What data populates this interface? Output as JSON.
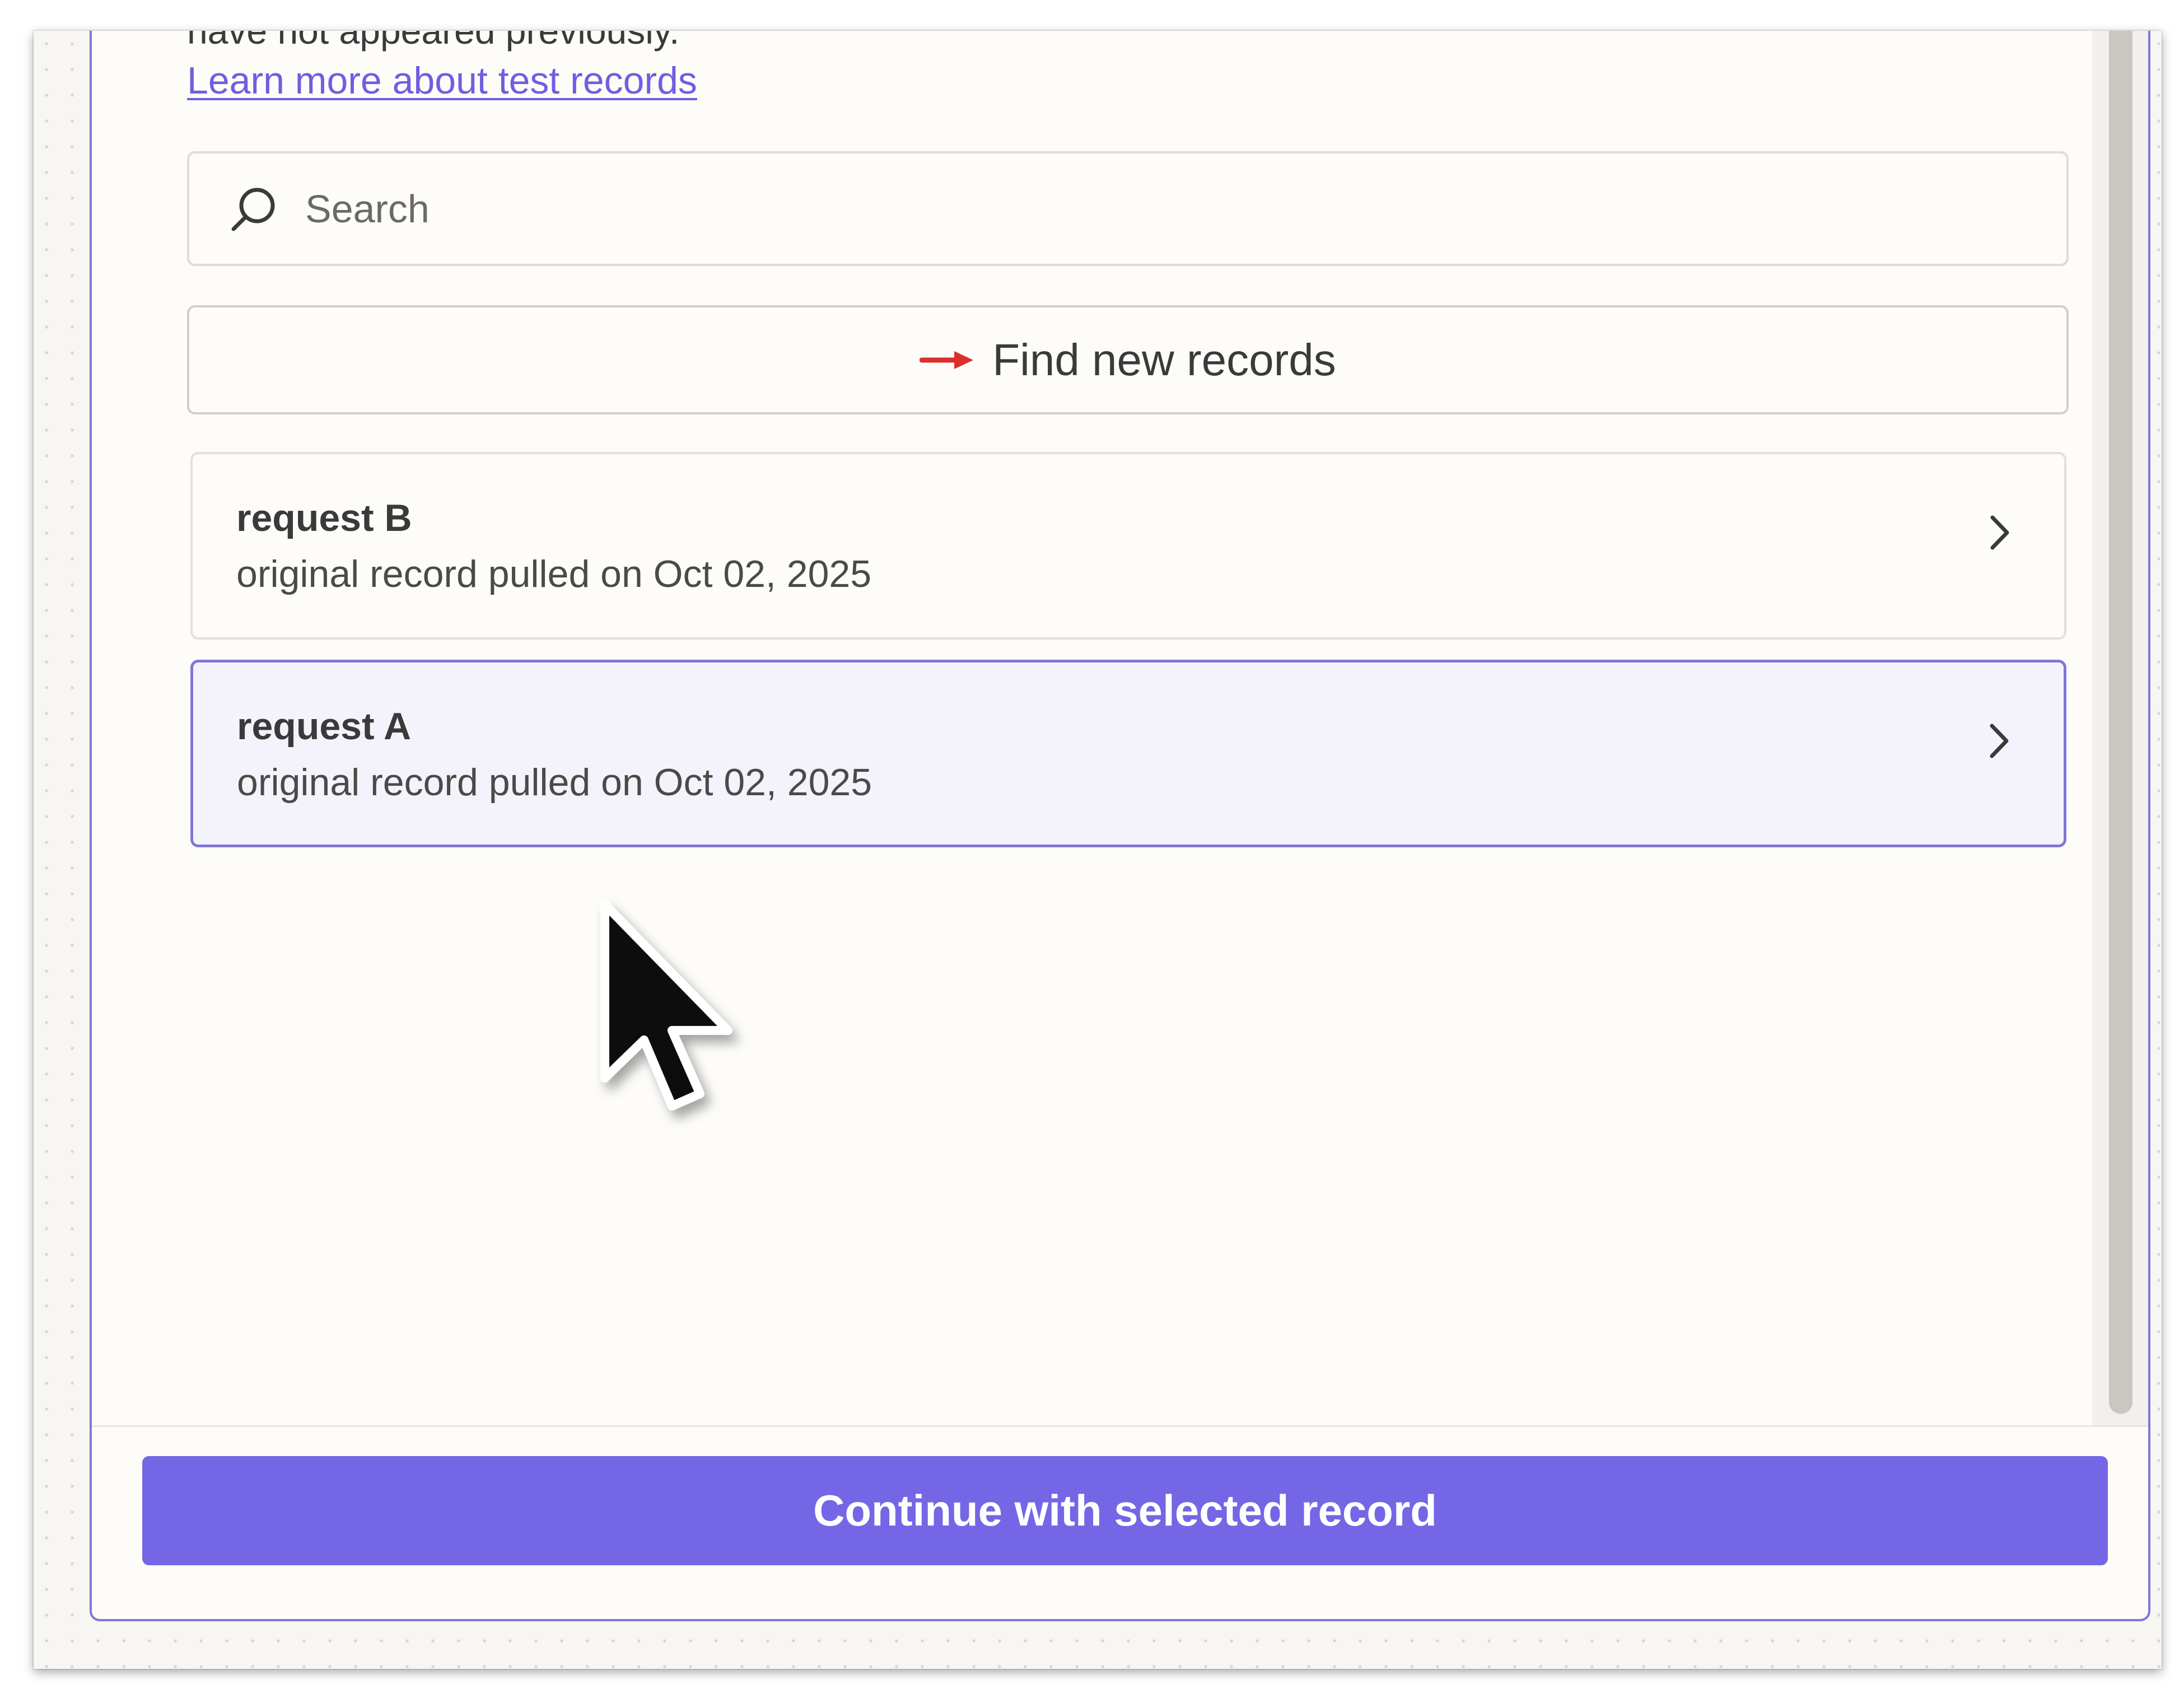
{
  "header": {
    "cutoff_text": "have not appeared previously.",
    "learn_link": "Learn more about test records"
  },
  "search": {
    "placeholder": "Search",
    "icon": "search-icon"
  },
  "find_button": {
    "label": "Find new records",
    "icon": "red-arrow-icon"
  },
  "records": [
    {
      "title": "request B",
      "subtitle": "original record pulled on Oct 02, 2025",
      "selected": false
    },
    {
      "title": "request A",
      "subtitle": "original record pulled on Oct 02, 2025",
      "selected": true
    }
  ],
  "footer": {
    "continue_label": "Continue with selected record"
  },
  "colors": {
    "accent": "#7566e6",
    "selected_border": "#7f78d6",
    "link": "#6e5ee2",
    "arrow": "#d9302c"
  }
}
